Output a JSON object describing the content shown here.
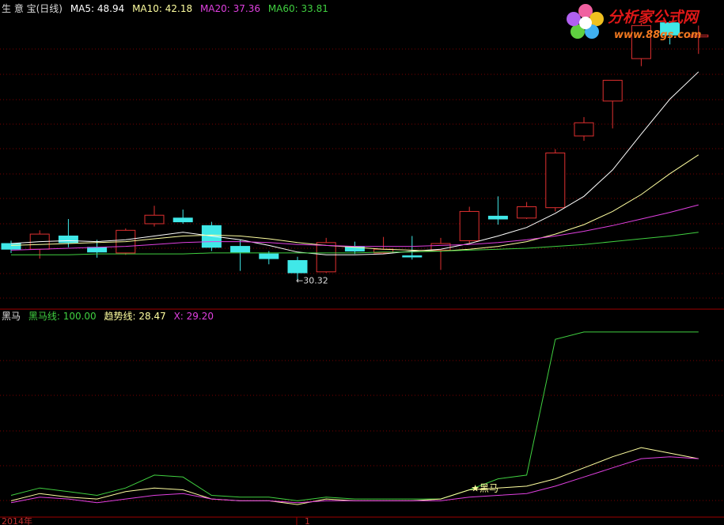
{
  "upper_legend": [
    {
      "text": "生 意 宝(日线)",
      "color": "#dcdcdc"
    },
    {
      "text": "MA5: 48.94",
      "color": "#ffffff"
    },
    {
      "text": "MA10: 42.18",
      "color": "#ffffa0"
    },
    {
      "text": "MA20: 37.36",
      "color": "#e040e0"
    },
    {
      "text": "MA60: 33.81",
      "color": "#40d040"
    }
  ],
  "lower_legend": [
    {
      "text": "黑马",
      "color": "#dcdcdc"
    },
    {
      "text": "黑马线: 100.00",
      "color": "#40d040"
    },
    {
      "text": "趋势线: 28.47",
      "color": "#ffffa0"
    },
    {
      "text": "X: 29.20",
      "color": "#e040e0"
    }
  ],
  "logo": {
    "title": "分析家公式网",
    "url": "www.88gs.com"
  },
  "colors": {
    "background": "#000000",
    "grid": "#7a0000",
    "up": "#e03030",
    "down": "#40e8e8",
    "ma5": "#ffffff",
    "ma10": "#ffffa0",
    "ma20": "#e040e0",
    "ma60": "#40d040",
    "logo_title": "#e01818",
    "logo_url": "#f07820"
  },
  "chart_data": [
    {
      "type": "candlestick",
      "title": "生 意 宝(日线)",
      "ylim": [
        28,
        58
      ],
      "low_annotation": {
        "text": "←30.32",
        "value": 30.32,
        "index": 10
      },
      "candles": [
        {
          "o": 34.2,
          "h": 34.5,
          "l": 33.2,
          "c": 33.6
        },
        {
          "o": 33.6,
          "h": 35.6,
          "l": 32.6,
          "c": 35.2
        },
        {
          "o": 35.0,
          "h": 36.8,
          "l": 33.8,
          "c": 34.3
        },
        {
          "o": 33.8,
          "h": 34.6,
          "l": 32.7,
          "c": 33.3
        },
        {
          "o": 33.2,
          "h": 35.8,
          "l": 33.0,
          "c": 35.6
        },
        {
          "o": 36.3,
          "h": 38.2,
          "l": 36.0,
          "c": 37.2
        },
        {
          "o": 36.9,
          "h": 37.8,
          "l": 36.3,
          "c": 36.5
        },
        {
          "o": 36.1,
          "h": 36.5,
          "l": 33.4,
          "c": 33.8
        },
        {
          "o": 33.9,
          "h": 34.6,
          "l": 31.3,
          "c": 33.3
        },
        {
          "o": 33.1,
          "h": 33.4,
          "l": 32.0,
          "c": 32.6
        },
        {
          "o": 32.4,
          "h": 32.8,
          "l": 30.32,
          "c": 31.1
        },
        {
          "o": 31.2,
          "h": 34.8,
          "l": 31.1,
          "c": 34.3
        },
        {
          "o": 33.9,
          "h": 34.4,
          "l": 33.1,
          "c": 33.4
        },
        {
          "o": 33.2,
          "h": 34.9,
          "l": 33.1,
          "c": 33.6
        },
        {
          "o": 32.9,
          "h": 35.0,
          "l": 32.5,
          "c": 32.8
        },
        {
          "o": 33.5,
          "h": 34.8,
          "l": 31.4,
          "c": 34.2
        },
        {
          "o": 34.5,
          "h": 38.1,
          "l": 34.2,
          "c": 37.6
        },
        {
          "o": 37.1,
          "h": 39.2,
          "l": 36.2,
          "c": 36.8
        },
        {
          "o": 36.9,
          "h": 38.6,
          "l": 36.8,
          "c": 38.1
        },
        {
          "o": 38.0,
          "h": 44.2,
          "l": 37.6,
          "c": 43.8
        },
        {
          "o": 45.6,
          "h": 47.6,
          "l": 45.1,
          "c": 47.0
        },
        {
          "o": 49.3,
          "h": 50.0,
          "l": 46.4,
          "c": 51.5
        },
        {
          "o": 53.8,
          "h": 57.6,
          "l": 53.0,
          "c": 57.3
        },
        {
          "o": 57.6,
          "h": 57.8,
          "l": 55.3,
          "c": 56.3
        },
        {
          "o": 56.1,
          "h": 57.3,
          "l": 54.3,
          "c": 56.3
        }
      ],
      "series": [
        {
          "name": "MA5",
          "values": [
            34.2,
            34.4,
            34.5,
            34.4,
            34.6,
            35.0,
            35.4,
            35.0,
            34.6,
            34.0,
            33.3,
            33.0,
            33.0,
            33.1,
            33.4,
            33.6,
            34.2,
            35.0,
            35.9,
            37.4,
            39.2,
            42.0,
            45.8,
            49.5,
            52.4
          ]
        },
        {
          "name": "MA10",
          "values": [
            34.0,
            34.1,
            34.2,
            34.3,
            34.4,
            34.7,
            35.0,
            35.1,
            35.0,
            34.7,
            34.3,
            34.0,
            33.8,
            33.6,
            33.5,
            33.4,
            33.6,
            33.9,
            34.4,
            35.2,
            36.2,
            37.6,
            39.4,
            41.6,
            43.6
          ]
        },
        {
          "name": "MA20",
          "values": [
            33.5,
            33.6,
            33.7,
            33.8,
            33.9,
            34.1,
            34.3,
            34.4,
            34.4,
            34.3,
            34.1,
            34.0,
            33.9,
            33.9,
            33.9,
            34.0,
            34.1,
            34.3,
            34.6,
            35.0,
            35.5,
            36.1,
            36.8,
            37.5,
            38.3
          ]
        },
        {
          "name": "MA60",
          "values": [
            33.0,
            33.0,
            33.0,
            33.1,
            33.1,
            33.1,
            33.1,
            33.2,
            33.2,
            33.2,
            33.2,
            33.2,
            33.2,
            33.3,
            33.3,
            33.4,
            33.5,
            33.6,
            33.7,
            33.9,
            34.1,
            34.4,
            34.7,
            35.0,
            35.4
          ]
        }
      ]
    },
    {
      "type": "line",
      "title": "黑马",
      "ylim": [
        0,
        106
      ],
      "annotation": {
        "text": "★黑马",
        "index": 16
      },
      "x_labels": [
        {
          "text": "2014年",
          "index": 0
        },
        {
          "text": "1",
          "index": 10
        }
      ],
      "series": [
        {
          "name": "黑马线",
          "values": [
            11,
            15,
            13,
            11,
            15,
            22,
            21,
            11,
            10,
            10,
            8,
            10,
            9,
            9,
            9,
            9,
            14,
            20,
            22,
            96,
            100,
            100,
            100,
            100,
            100
          ]
        },
        {
          "name": "趋势线",
          "values": [
            8,
            12,
            10,
            9,
            13,
            15,
            14,
            9,
            8,
            8,
            6,
            9,
            8,
            8,
            8,
            9,
            14,
            15,
            16,
            20,
            26,
            32,
            37,
            34,
            31
          ]
        },
        {
          "name": "X",
          "values": [
            7,
            10,
            9,
            7,
            9,
            11,
            12,
            9,
            8,
            8,
            7,
            8,
            8,
            8,
            8,
            8,
            10,
            11,
            12,
            16,
            21,
            26,
            31,
            32,
            31
          ]
        }
      ]
    }
  ]
}
